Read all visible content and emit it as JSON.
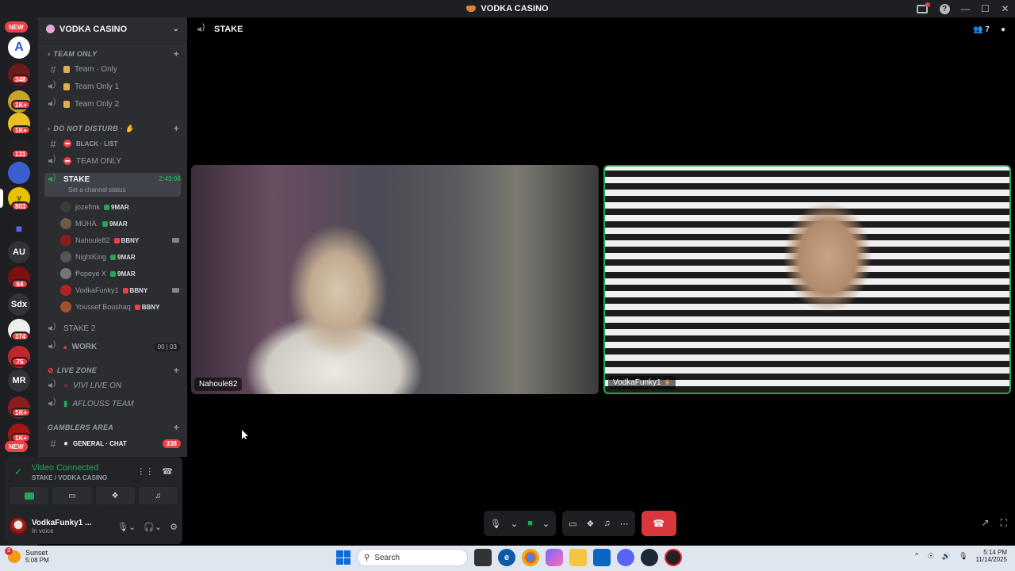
{
  "window": {
    "title": "VODKA CASINO"
  },
  "rail": {
    "new_top": "NEW",
    "new_bottom": "NEW",
    "badges": [
      "348",
      "1K+",
      "1K+",
      "131",
      "803",
      "64",
      "374",
      "75",
      "1K+",
      "1K+"
    ],
    "text_servers": [
      "AU",
      "Sdx",
      "MR"
    ]
  },
  "sidebar": {
    "guild_name": "VODKA CASINO",
    "categories": {
      "team_only": "TEAM ONLY",
      "do_not_disturb": "DO NOT DISTURB · ✋",
      "live_zone": "LIVE ZONE",
      "gamblers_area": "GAMBLERS AREA"
    },
    "channels": {
      "team_only_text": "Team · Only",
      "team_only_1": "Team Only 1",
      "team_only_2": "Team Only 2",
      "black_list": "BLACK · LIST",
      "team_only_dnd": "TEAM ONLY",
      "stake": "STAKE",
      "stake_status": "Set a channel status",
      "stake_timer": "2:43:06",
      "stake2": "STAKE 2",
      "work": "WORK",
      "work_count_a": "00",
      "work_count_b": "03",
      "vivi": "VIVI LIVE ON",
      "aflouss": "AFLOUSS TEAM",
      "general_chat": "GENERAL · CHAT",
      "general_unread": "338"
    },
    "members": [
      {
        "name": "jozefmk",
        "tag": "9MAR",
        "tag_color": "#23a55a",
        "avatar": "#3a3a3a",
        "camera": false
      },
      {
        "name": "MUHA.",
        "tag": "9MAR",
        "tag_color": "#23a55a",
        "avatar": "#6b5a45",
        "camera": false
      },
      {
        "name": "Nahoule82",
        "tag": "BBNY",
        "tag_color": "#f23f43",
        "avatar": "#8a1c1c",
        "camera": true
      },
      {
        "name": "NightKing",
        "tag": "9MAR",
        "tag_color": "#23a55a",
        "avatar": "#555",
        "camera": false
      },
      {
        "name": "Ᵽopeye X",
        "tag": "9MAR",
        "tag_color": "#23a55a",
        "avatar": "#777",
        "camera": false
      },
      {
        "name": "VodkaFunky1",
        "tag": "BBNY",
        "tag_color": "#f23f43",
        "avatar": "#b22222",
        "camera": true
      },
      {
        "name": "Youssef Boushaq",
        "tag": "BBNY",
        "tag_color": "#f23f43",
        "avatar": "#a0522d",
        "camera": false
      }
    ]
  },
  "voice_panel": {
    "status": "Video Connected",
    "location": "STAKE / VODKA CASINO"
  },
  "user_panel": {
    "username": "VodkaFunky1 ...",
    "status": "In voice"
  },
  "main": {
    "channel_title": "STAKE",
    "participant_count": "7",
    "tiles": [
      {
        "name": "Nahoule82",
        "crown": false
      },
      {
        "name": "VodkaFunky1",
        "crown": true
      }
    ]
  },
  "taskbar": {
    "weather_label": "Sunset",
    "weather_time": "5:08 PM",
    "weather_badge": "3",
    "search_placeholder": "Search",
    "time": "5:14 PM",
    "date": "11/14/2025"
  },
  "colors": {
    "accent_green": "#23a55a",
    "danger_red": "#da373c",
    "sidebar_bg": "#2b2d31",
    "rail_bg": "#1e1f22"
  }
}
